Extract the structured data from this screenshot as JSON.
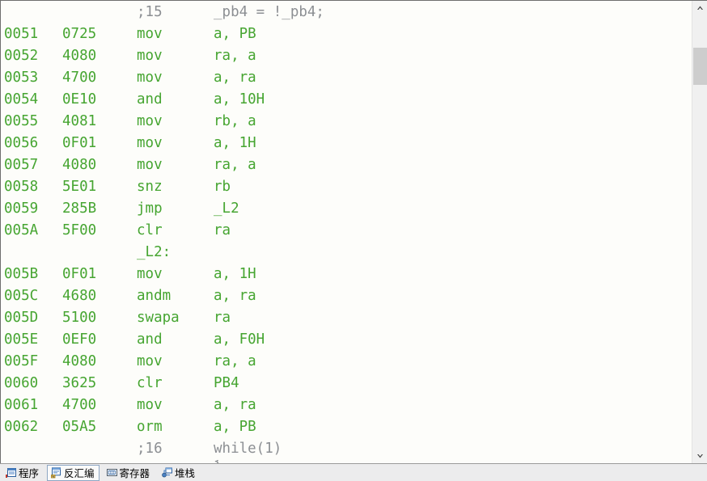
{
  "window": {
    "background": "#d4d8df",
    "pane_background": "#fdfdfa"
  },
  "colors": {
    "code_green": "#46a531",
    "comment_gray": "#8c8f93",
    "tab_strip_bg": "#ececed",
    "scrollbar_track": "#f0f0f0",
    "scrollbar_thumb": "#cdcdcd",
    "active_tab_border": "#8ea7c4"
  },
  "disassembly": {
    "columns": [
      "address",
      "opcode",
      "mnemonic",
      "operands"
    ],
    "rows": [
      {
        "kind": "source",
        "address": "",
        "opcode": "",
        "mnemonic": ";15",
        "operands": "_pb4 = !_pb4;"
      },
      {
        "kind": "code",
        "address": "0051",
        "opcode": "0725",
        "mnemonic": "mov",
        "operands": "a, PB"
      },
      {
        "kind": "code",
        "address": "0052",
        "opcode": "4080",
        "mnemonic": "mov",
        "operands": "ra, a"
      },
      {
        "kind": "code",
        "address": "0053",
        "opcode": "4700",
        "mnemonic": "mov",
        "operands": "a, ra"
      },
      {
        "kind": "code",
        "address": "0054",
        "opcode": "0E10",
        "mnemonic": "and",
        "operands": "a, 10H"
      },
      {
        "kind": "code",
        "address": "0055",
        "opcode": "4081",
        "mnemonic": "mov",
        "operands": "rb, a"
      },
      {
        "kind": "code",
        "address": "0056",
        "opcode": "0F01",
        "mnemonic": "mov",
        "operands": "a, 1H"
      },
      {
        "kind": "code",
        "address": "0057",
        "opcode": "4080",
        "mnemonic": "mov",
        "operands": "ra, a"
      },
      {
        "kind": "code",
        "address": "0058",
        "opcode": "5E01",
        "mnemonic": "snz",
        "operands": "rb"
      },
      {
        "kind": "code",
        "address": "0059",
        "opcode": "285B",
        "mnemonic": "jmp",
        "operands": "_L2"
      },
      {
        "kind": "code",
        "address": "005A",
        "opcode": "5F00",
        "mnemonic": "clr",
        "operands": "ra"
      },
      {
        "kind": "label",
        "address": "",
        "opcode": "",
        "mnemonic": "_L2:",
        "operands": ""
      },
      {
        "kind": "code",
        "address": "005B",
        "opcode": "0F01",
        "mnemonic": "mov",
        "operands": "a, 1H"
      },
      {
        "kind": "code",
        "address": "005C",
        "opcode": "4680",
        "mnemonic": "andm",
        "operands": "a, ra"
      },
      {
        "kind": "code",
        "address": "005D",
        "opcode": "5100",
        "mnemonic": "swapa",
        "operands": "ra"
      },
      {
        "kind": "code",
        "address": "005E",
        "opcode": "0EF0",
        "mnemonic": "and",
        "operands": "a, F0H"
      },
      {
        "kind": "code",
        "address": "005F",
        "opcode": "4080",
        "mnemonic": "mov",
        "operands": "ra, a"
      },
      {
        "kind": "code",
        "address": "0060",
        "opcode": "3625",
        "mnemonic": "clr",
        "operands": "PB4"
      },
      {
        "kind": "code",
        "address": "0061",
        "opcode": "4700",
        "mnemonic": "mov",
        "operands": "a, ra"
      },
      {
        "kind": "code",
        "address": "0062",
        "opcode": "05A5",
        "mnemonic": "orm",
        "operands": "a, PB"
      },
      {
        "kind": "source",
        "address": "",
        "opcode": "",
        "mnemonic": ";16",
        "operands": "while(1)"
      },
      {
        "kind": "source",
        "address": "",
        "opcode": "",
        "mnemonic": "",
        "operands": "{"
      }
    ]
  },
  "scrollbar": {
    "up_arrow": "scroll-up-icon",
    "down_arrow": "scroll-down-icon",
    "thumb_label": "scroll-thumb"
  },
  "tabs": [
    {
      "label": "程序",
      "icon": "program-icon",
      "active": false
    },
    {
      "label": "反汇编",
      "icon": "disassembly-icon",
      "active": true
    },
    {
      "label": "寄存器",
      "icon": "registers-icon",
      "active": false
    },
    {
      "label": "堆栈",
      "icon": "stack-icon",
      "active": false
    }
  ]
}
